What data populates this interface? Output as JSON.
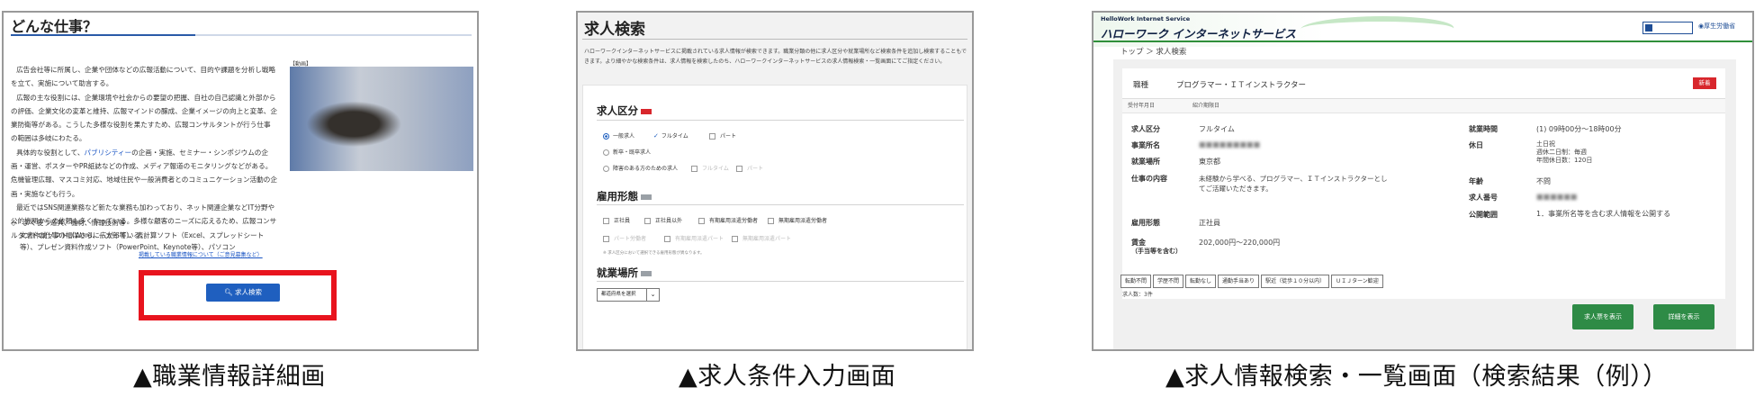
{
  "captions": {
    "left": "▲職業情報詳細画",
    "middle": "▲求人条件入力画面",
    "right": "▲求人情報検索・一覧画面（検索結果（例））"
  },
  "s1": {
    "title": "どんな仕事？",
    "paras": [
      "広告会社等に所属し、企業や団体などの広報活動について、目的や課題を分析し戦略を立て、実施について助言する。",
      "広報の主な役割には、企業環境や社会からの要望の把握、自社の自己認識と外部からの評価、企業文化の変革と維持、広報マインドの醸成、企業イメージの向上と変革、企業防衛等がある。こうした多様な役割を果たすため、広報コンサルタントが行う仕事の範囲は多岐にわたる。",
      "最近ではSNS関連業務など新たな業務も加わっており、ネット関連企業などIT分野や公的機関からの依頼も多くなっている。多様な顧客のニーズに応えるため、広報コンサルタントの仕事の幅はさらに広がっている。"
    ],
    "para2_before": "具体的な役割として、",
    "para2_link": "パブリシティー",
    "para2_after": "の企画・実施、セミナー・シンポジウムの企画・運営、ポスターやPR紙誌などの作成、メディア報道のモニタリングなどがある。危機管理広報、マスコミ対応、地域住民や一般消費者とのコミュニケーション活動の企画・実施なども行う。",
    "video_label": "【動画】",
    "tools_head": "◇　よく使う道具、機材、情報技術等",
    "tools_body": "文書作成ソフト（Word、一太郎等）、表計算ソフト（Excel、スプレッドシート等）、プレゼン資料作成ソフト（PowerPoint、Keynote等）、パソコン",
    "note": "掲載している職業情報について（ご意見募集など）",
    "search_button": "求人検索"
  },
  "s2": {
    "title": "求人検索",
    "desc": "ハローワークインターネットサービスに掲載されている求人情報が検索できます。職業分類の他に求人区分や就業場所など検索条件を追加し検索することもできます。より細やかな検索条件は、求人情報を検索したのち、ハローワークインターネットサービスの求人情報検索・一覧画面にてご指定ください。",
    "sections": {
      "kyujin": "求人区分",
      "koyo": "雇用形態",
      "basho": "就業場所"
    },
    "opts": {
      "ippan": "一般求人",
      "fulltime": "フルタイム",
      "part": "パート",
      "shinsotsu": "新卒・既卒求人",
      "shogai": "障害のある方のための求人",
      "fulltime2": "フルタイム",
      "part2": "パート",
      "seishain": "正社員",
      "seishain_igai": "正社員以外",
      "yuki_haken": "有期雇用派遣労働者",
      "muki_haken": "無期雇用派遣労働者",
      "part_seishain": "パート労働者",
      "yuki_part": "有期雇用派遣パート",
      "muki_part": "無期雇用派遣パート"
    },
    "note": "※ 求人区分において選択できる雇用形態が異なります。",
    "select": "都道府県を選択"
  },
  "s3": {
    "eng": "HelloWork Internet Service",
    "logo": "ハローワーク インターネットサービス",
    "ministry": "厚生労働省",
    "crumb": "トップ ＞ 求人検索",
    "job_label": "職種",
    "job_value": "プログラマー・ＩＴインストラクター",
    "badge": "新着",
    "datebar": "受付年月日　　　　　　　紹介期限日",
    "left": [
      {
        "k": "求人区分",
        "v": "フルタイム"
      },
      {
        "k": "事業所名",
        "v": ""
      },
      {
        "k": "就業場所",
        "v": "東京都"
      },
      {
        "k": "仕事の内容",
        "v": "未経験から学べる、プログラマー、ＩＴインストラクターとしてご活躍いただきます。"
      },
      {
        "k": "雇用形態",
        "v": "正社員"
      },
      {
        "k": "賃金",
        "v": "202,000円～220,000円"
      }
    ],
    "chin_sub": "（手当等を含む）",
    "right": [
      {
        "k": "就業時間",
        "v": "(1) 09時00分～18時00分"
      },
      {
        "k": "休日",
        "v": "土日祝\n週休二日制：毎週\n年間休日数：120日"
      },
      {
        "k": "年齢",
        "v": "不問"
      },
      {
        "k": "求人番号",
        "v": ""
      },
      {
        "k": "公開範囲",
        "v": "1．事業所名等を含む求人情報を公開する"
      }
    ],
    "tags": [
      "転勤不問",
      "学歴不問",
      "転勤なし",
      "通勤手当あり",
      "駅近（徒歩１０分以内）",
      "ＵＩＪターン歓迎"
    ],
    "count": "求人数：3件",
    "btn_table": "求人票を表示",
    "btn_detail": "詳細を表示"
  }
}
